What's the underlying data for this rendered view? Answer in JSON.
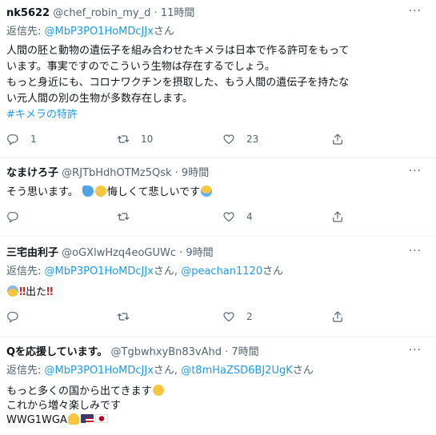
{
  "tweets": [
    {
      "display_name": "nk5622",
      "handle": "@chef_robin_my_d",
      "time": "· 11時間",
      "reply_label": "返信先:",
      "reply_to": "@MbP3PO1HoMDcJJx",
      "reply_suffix": "さん",
      "body": [
        "人間の胚と動物の遺伝子を組み合わせたキメラは日本で作る許可をもって",
        "います。事実ですのでこういう生物は存在するでしょう。",
        "もっと身近にも、コロナワクチンを摂取した、もう人間の遺伝子を持たな",
        "い元人間の別の生物が多数存在します。"
      ],
      "hashtag": "#キメラの特許",
      "replies": "1",
      "retweets": "10",
      "likes": "23"
    },
    {
      "display_name": "なまけろ子",
      "handle": "@RJTbHdhOTMz5Qsk",
      "time": "· 9時間",
      "body_text": "そう思います。",
      "body_text2": "悔しくて悲しいです",
      "replies": "",
      "retweets": "",
      "likes": "4"
    },
    {
      "display_name": "三宅由利子",
      "handle": "@oGXlwHzq4eoGUWc",
      "time": "· 9時間",
      "reply_label": "返信先:",
      "reply_to": "@MbP3PO1HoMDcJJx",
      "reply_sep": "さん,",
      "reply_to2": "@peachan1120",
      "reply_suffix": "さん",
      "body_text": "出た",
      "replies": "",
      "retweets": "",
      "likes": "2"
    },
    {
      "display_name": "Qを応援しています。",
      "handle": "@TgbwhxyBn83vAhd",
      "time": "· 7時間",
      "reply_label": "返信先:",
      "reply_to": "@MbP3PO1HoMDcJJx",
      "reply_sep": "さん,",
      "reply_to2": "@t8mHaZSD6BJ2UgK",
      "reply_suffix": "さん",
      "body_line1": "もっと多くの国から出てきます",
      "body_line2": "これから増々楽しみです",
      "body_line3": "WWG1WGA"
    }
  ],
  "icons": [
    "reply-icon",
    "retweet-icon",
    "like-icon",
    "share-icon",
    "more-icon"
  ],
  "colors": {
    "link": "#1d9bf0",
    "muted": "#536471",
    "text": "#0f1419",
    "divider": "#eff3f4"
  }
}
